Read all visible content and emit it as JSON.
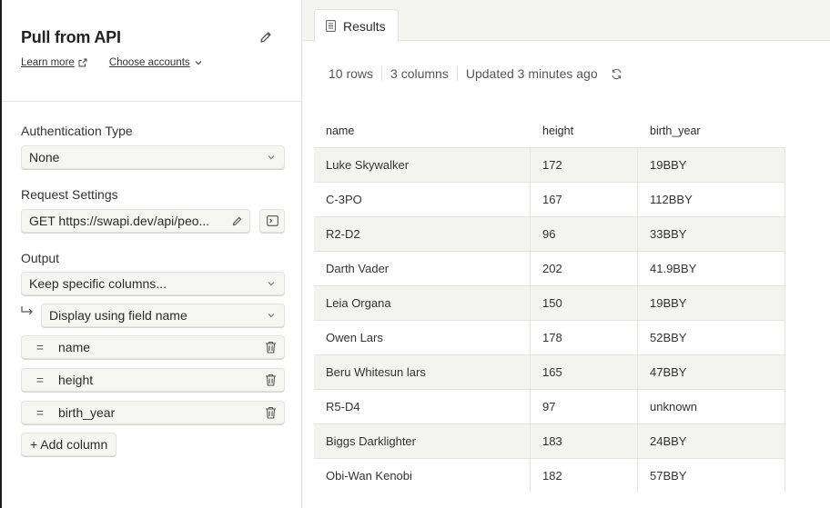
{
  "panel": {
    "title": "Pull from API",
    "learn_more": "Learn more",
    "choose_accounts": "Choose accounts"
  },
  "auth": {
    "label": "Authentication Type",
    "value": "None"
  },
  "request": {
    "label": "Request Settings",
    "value": "GET https://swapi.dev/api/peo..."
  },
  "output": {
    "label": "Output",
    "mode": "Keep specific columns...",
    "display": "Display using field name",
    "columns": [
      "name",
      "height",
      "birth_year"
    ],
    "add_column": "+ Add column"
  },
  "results": {
    "tab": "Results",
    "rows_count": "10 rows",
    "columns_count": "3 columns",
    "updated": "Updated 3 minutes ago",
    "headers": [
      "name",
      "height",
      "birth_year"
    ],
    "rows": [
      [
        "Luke Skywalker",
        "172",
        "19BBY"
      ],
      [
        "C-3PO",
        "167",
        "112BBY"
      ],
      [
        "R2-D2",
        "96",
        "33BBY"
      ],
      [
        "Darth Vader",
        "202",
        "41.9BBY"
      ],
      [
        "Leia Organa",
        "150",
        "19BBY"
      ],
      [
        "Owen Lars",
        "178",
        "52BBY"
      ],
      [
        "Beru Whitesun lars",
        "165",
        "47BBY"
      ],
      [
        "R5-D4",
        "97",
        "unknown"
      ],
      [
        "Biggs Darklighter",
        "183",
        "24BBY"
      ],
      [
        "Obi-Wan Kenobi",
        "182",
        "57BBY"
      ]
    ]
  },
  "icons": {
    "edit": "pencil-icon",
    "external": "external-link-icon",
    "chevron": "chevron-down-icon",
    "terminal": "terminal-icon",
    "indent": "return-arrow-icon",
    "drag": "equals-icon",
    "trash": "trash-icon",
    "tab": "table-doc-icon",
    "refresh": "refresh-icon"
  }
}
